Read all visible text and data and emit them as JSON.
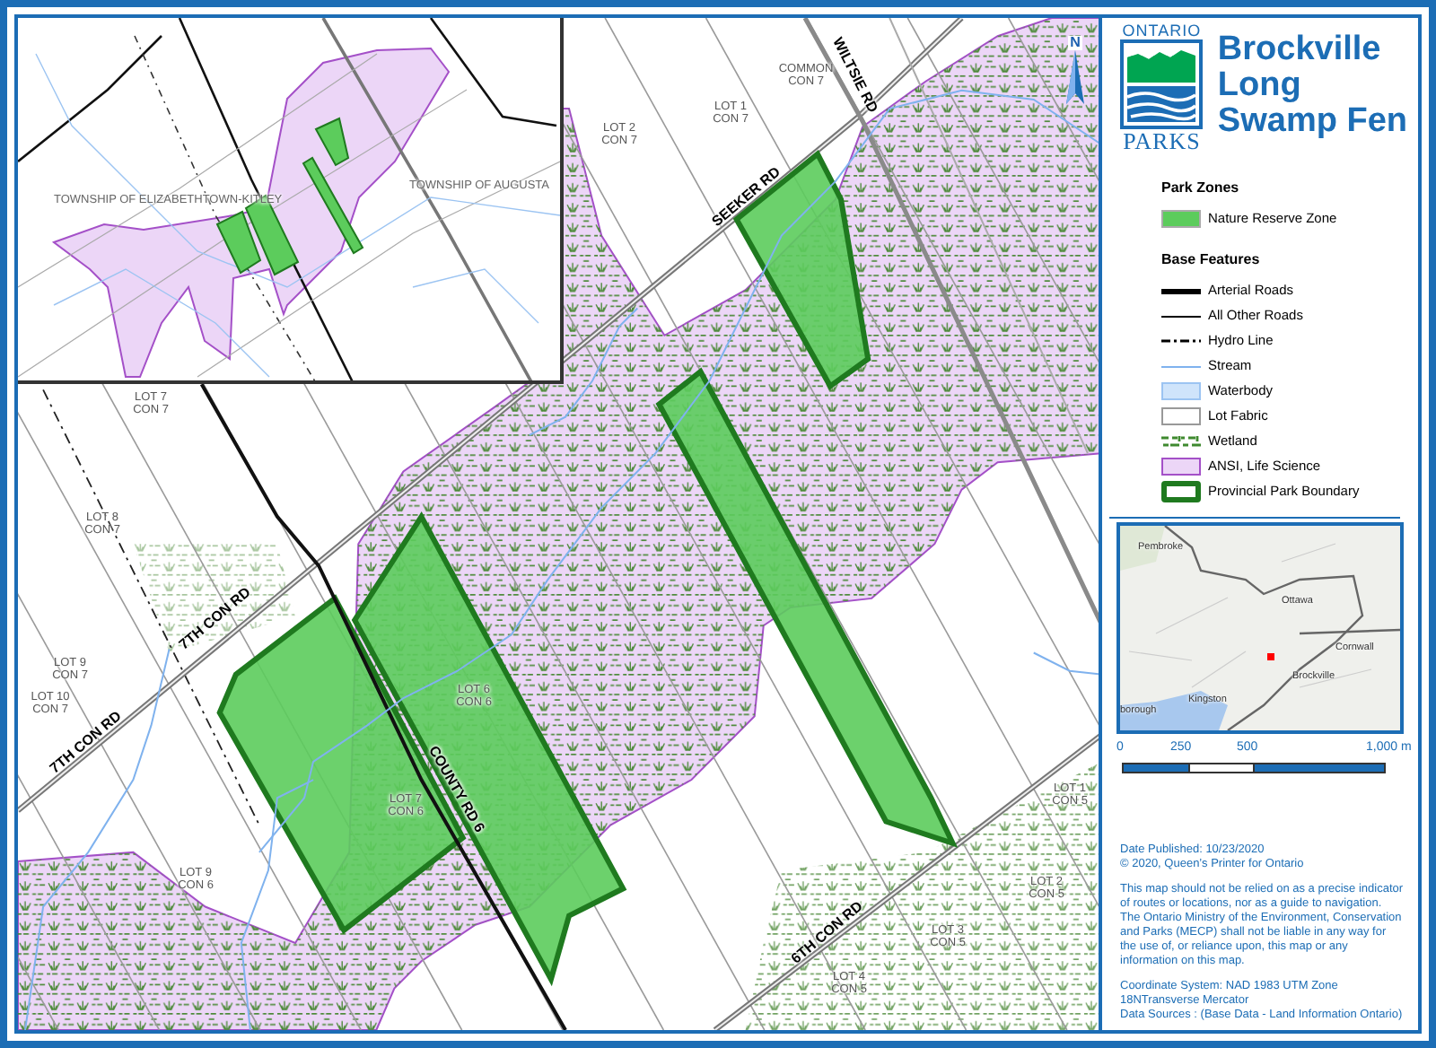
{
  "main_map": {
    "north_arrow": {
      "label": "N"
    },
    "road_labels": [
      "SEEKER RD",
      "WILTSIE RD",
      "7TH CON RD",
      "7TH CON RD",
      "COUNTY RD 6",
      "6TH CON RD"
    ],
    "lot_labels": [
      {
        "lines": [
          "LOT 2",
          "CON 7"
        ]
      },
      {
        "lines": [
          "LOT 1",
          "CON 7"
        ]
      },
      {
        "lines": [
          "COMMON",
          "CON 7"
        ]
      },
      {
        "lines": [
          "LOT 7",
          "CON 7"
        ]
      },
      {
        "lines": [
          "LOT 8",
          "CON 7"
        ]
      },
      {
        "lines": [
          "LOT 9",
          "CON 7"
        ]
      },
      {
        "lines": [
          "LOT 10",
          "CON 7"
        ]
      },
      {
        "lines": [
          "LOT 9",
          "CON 6"
        ]
      },
      {
        "lines": [
          "LOT 1",
          "CON 5"
        ]
      },
      {
        "lines": [
          "LOT 6",
          "CON 6"
        ]
      },
      {
        "lines": [
          "LOT 7",
          "CON 6"
        ]
      },
      {
        "lines": [
          "LOT 2",
          "CON 5"
        ]
      },
      {
        "lines": [
          "LOT 3",
          "CON 5"
        ]
      },
      {
        "lines": [
          "LOT 4",
          "CON 5"
        ]
      }
    ]
  },
  "inset_map": {
    "labels": [
      "TOWNSHIP OF ELIZABETHTOWN-KITLEY",
      "TOWNSHIP OF AUGUSTA"
    ]
  },
  "logo": {
    "top": "ONTARIO",
    "bottom": "PARKS"
  },
  "title_lines": [
    "Brockville",
    "Long",
    "Swamp Fen"
  ],
  "legend": {
    "sections": [
      {
        "heading": "Park Zones",
        "items": [
          {
            "kind": "zone",
            "label": "Nature Reserve Zone"
          }
        ]
      },
      {
        "heading": "Base Features",
        "items": [
          {
            "kind": "arterial",
            "label": "Arterial Roads"
          },
          {
            "kind": "road",
            "label": "All Other Roads"
          },
          {
            "kind": "hydro",
            "label": "Hydro Line"
          },
          {
            "kind": "stream",
            "label": "Stream"
          },
          {
            "kind": "waterbody",
            "label": "Waterbody"
          },
          {
            "kind": "lot",
            "label": "Lot Fabric"
          },
          {
            "kind": "wetland",
            "label": "Wetland"
          },
          {
            "kind": "ansi",
            "label": "ANSI, Life Science"
          },
          {
            "kind": "boundary",
            "label": "Provincial Park Boundary"
          }
        ]
      }
    ]
  },
  "locator_map": {
    "places": [
      "Pembroke",
      "Ottawa",
      "Cornwall",
      "Brockville",
      "Kingston",
      "borough"
    ]
  },
  "scale_bar": {
    "ticks": [
      "0",
      "250",
      "500",
      "1,000 m"
    ]
  },
  "notes": {
    "published": "Date Published: 10/23/2020",
    "copyright": "© 2020, Queen’s Printer for Ontario",
    "disclaimer": "This map should not be relied on as a precise indicator of routes or locations, nor as a guide to navigation. The Ontario Ministry of the Environment, Conservation and Parks (MECP) shall not be liable in any way for the use of, or reliance upon, this map or any information on this map.",
    "coordinate_system": "Coordinate System: NAD 1983 UTM Zone 18NTransverse Mercator",
    "data_sources": "Data Sources : (Base Data - Land Information Ontario)"
  }
}
